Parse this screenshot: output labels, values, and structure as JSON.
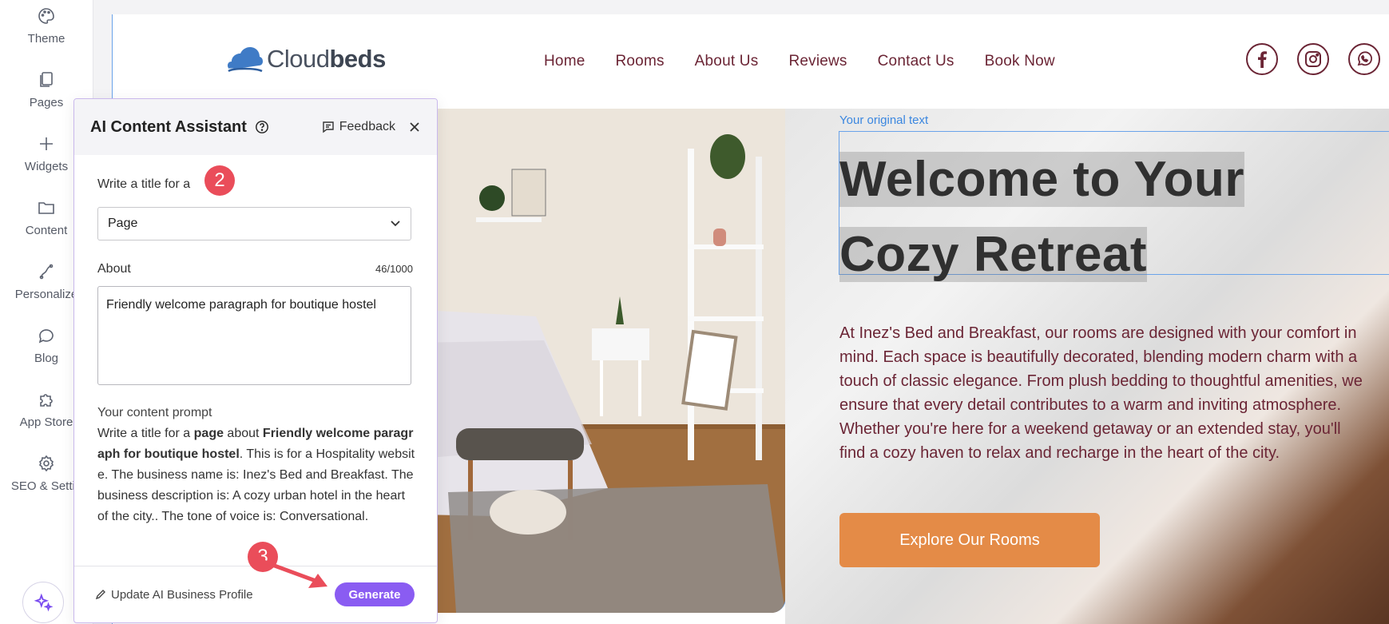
{
  "sidebar": {
    "items": [
      {
        "label": "Theme",
        "icon": "palette-icon"
      },
      {
        "label": "Pages",
        "icon": "pages-icon"
      },
      {
        "label": "Widgets",
        "icon": "plus-icon"
      },
      {
        "label": "Content",
        "icon": "folder-icon"
      },
      {
        "label": "Personalize",
        "icon": "personalize-icon"
      },
      {
        "label": "Blog",
        "icon": "chat-bubble-icon"
      },
      {
        "label": "App Store",
        "icon": "puzzle-icon"
      },
      {
        "label": "SEO & Settin",
        "icon": "gear-icon"
      }
    ],
    "ai_button_icon": "sparkle-icon"
  },
  "site": {
    "logo_light": "Cloud",
    "logo_bold": "beds",
    "nav": [
      "Home",
      "Rooms",
      "About Us",
      "Reviews",
      "Contact Us",
      "Book Now"
    ],
    "social": [
      "facebook-icon",
      "instagram-icon",
      "whatsapp-icon"
    ],
    "original_label": "Your original text",
    "hero_title_line1": "Welcome to Your",
    "hero_title_line2": "Cozy Retreat",
    "hero_body": "At Inez's Bed and Breakfast, our rooms are designed with your comfort in mind. Each space is beautifully decorated, blending modern charm with a touch of classic elegance. From plush bedding to thoughtful amenities, we ensure that every detail contributes to a warm and inviting atmosphere. Whether you're here for a weekend getaway or an extended stay, you'll find a cozy haven to relax and recharge in the heart of the city.",
    "cta_label": "Explore Our Rooms"
  },
  "panel": {
    "title": "AI Content Assistant",
    "feedback_label": "Feedback",
    "write_label": "Write a title for a",
    "step2": "2",
    "select_value": "Page",
    "about_label": "About",
    "counter": "46/1000",
    "about_value": "Friendly welcome paragraph for boutique hostel",
    "prompt_heading": "Your content prompt",
    "prompt_pre": "Write a title for a ",
    "prompt_type": "page",
    "prompt_mid": " about ",
    "prompt_topic": "Friendly welcome paragraph for boutique hostel",
    "prompt_rest": ". This is for a Hospitality website. The business name is: Inez's Bed and Breakfast. The business description is: A cozy urban hotel in the heart of the city.. The tone of voice is: Conversational.",
    "update_label": "Update AI Business Profile",
    "generate_label": "Generate",
    "step3": "3"
  },
  "colors": {
    "accent": "#8a5cf2",
    "brand_text": "#6b2535",
    "cta": "#e48b47",
    "badge": "#ea4d5a",
    "selection": "#6aa3ea"
  }
}
